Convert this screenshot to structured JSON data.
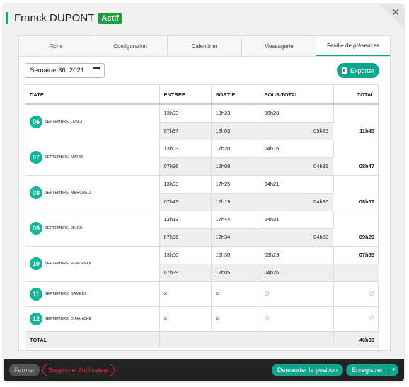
{
  "header": {
    "name": "Franck DUPONT",
    "status": "Actif"
  },
  "tabs": [
    "Fiche",
    "Configuration",
    "Calendrier",
    "Messagerie",
    "Feuille de présences"
  ],
  "week": {
    "value": "Semaine 36, 2021"
  },
  "export_label": "Exporter",
  "columns": [
    "DATE",
    "ENTREE",
    "SORTIE",
    "SOUS-TOTAL",
    "TOTAL"
  ],
  "days": [
    {
      "num": "06",
      "label": "SEPTEMBRE, LUNDI",
      "rows": [
        [
          "13h03",
          "19h23",
          "06h20"
        ],
        [
          "07h37",
          "13h03",
          "05h25"
        ]
      ],
      "total": "11h45"
    },
    {
      "num": "07",
      "label": "SEPTEMBRE, MARDI",
      "rows": [
        [
          "13h03",
          "17h20",
          "04h16"
        ],
        [
          "07h36",
          "12h08",
          "04h31"
        ]
      ],
      "total": "08h47"
    },
    {
      "num": "08",
      "label": "SEPTEMBRE, MERCREDI",
      "rows": [
        [
          "13h03",
          "17h25",
          "04h21"
        ],
        [
          "07h43",
          "12h19",
          "04h36"
        ]
      ],
      "total": "08h57"
    },
    {
      "num": "09",
      "label": "SEPTEMBRE, JEUDI",
      "rows": [
        [
          "13h13",
          "17h44",
          "04h31"
        ],
        [
          "07h36",
          "12h34",
          "04h58"
        ]
      ],
      "total": "09h29"
    },
    {
      "num": "10",
      "label": "SEPTEMBRE, VENDREDI",
      "rows": [
        [
          "13h00",
          "16h30",
          "03h29"
        ],
        [
          "07h39",
          "12h05",
          "04h26"
        ]
      ],
      "total": "07h55"
    },
    {
      "num": "11",
      "label": "SEPTEMBRE, SAMEDI"
    },
    {
      "num": "12",
      "label": "SEPTEMBRE, DIMANCHE"
    }
  ],
  "footer_row": {
    "label": "TOTAL",
    "value": "46h53"
  },
  "symbols": {
    "cross": "×",
    "empty": "∅"
  },
  "buttons": {
    "close": "Fermer",
    "delete": "Supprimer l'utilisateur",
    "position": "Demander la position",
    "save": "Enregistrer"
  },
  "colors": {
    "accent": "#0fa68e",
    "status": "#1e9e3a",
    "danger": "#e22c4b"
  }
}
